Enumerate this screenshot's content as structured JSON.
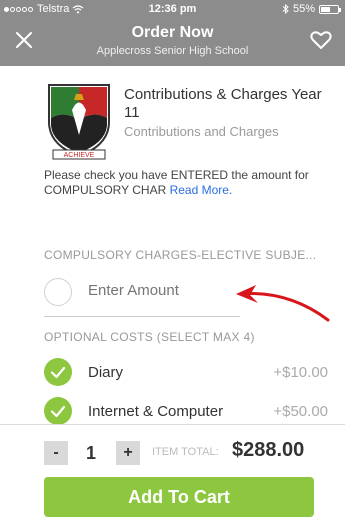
{
  "status_bar": {
    "carrier": "Telstra",
    "time": "12:36 pm",
    "battery": "55%",
    "battery_level": 0.55
  },
  "header": {
    "title": "Order Now",
    "subtitle": "Applecross Senior High School",
    "close_icon": "close-icon",
    "favorite_icon": "heart-icon"
  },
  "product": {
    "title": "Contributions & Charges Year 11",
    "category": "Contributions and Charges",
    "image_text": "ACHIEVE"
  },
  "notice": {
    "text": "Please check you have ENTERED the amount for COMPULSORY CHAR",
    "read_more": "Read More."
  },
  "sections": {
    "compulsory": "COMPULSORY CHARGES-ELECTIVE SUBJE...",
    "optional": "OPTIONAL COSTS (SELECT MAX 4)"
  },
  "amount_input": {
    "placeholder": "Enter Amount"
  },
  "options": [
    {
      "label": "Diary",
      "price": "+$10.00",
      "checked": true
    },
    {
      "label": "Internet & Computer",
      "price": "+$50.00",
      "checked": true
    }
  ],
  "cart": {
    "minus": "-",
    "quantity": "1",
    "plus": "+",
    "total_label": "ITEM TOTAL:",
    "total_value": "$288.00",
    "button": "Add To Cart"
  },
  "colors": {
    "header": "#8c8c8c",
    "accent_green": "#8dc63f",
    "link_blue": "#2a6ee0",
    "arrow_red": "#d9151b"
  }
}
